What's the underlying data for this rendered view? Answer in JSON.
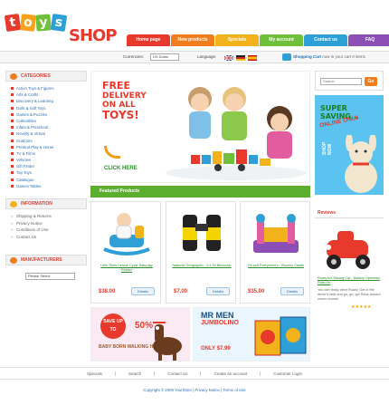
{
  "logo": {
    "blocks": [
      "t",
      "o",
      "y",
      "s"
    ],
    "shop": "SHOP"
  },
  "nav": [
    {
      "label": "Home page",
      "color": "#e7392c"
    },
    {
      "label": "New products",
      "color": "#f07e1f"
    },
    {
      "label": "Specials",
      "color": "#f2b21b"
    },
    {
      "label": "My account",
      "color": "#6fbf3a"
    },
    {
      "label": "Contact us",
      "color": "#2f9fd8"
    },
    {
      "label": "FAQ",
      "color": "#8b4fb5"
    }
  ],
  "toolbar": {
    "currencies_label": "Currencies:",
    "currency_value": "US Dollar",
    "language_label": "Language:",
    "cart_label": "Shopping Cart",
    "cart_status": "now in your cart",
    "cart_count": "0",
    "cart_items": "items"
  },
  "left": {
    "categories_title": "CATEGORIES",
    "categories": [
      "Action Toys & Figures",
      "Arts & Crafts",
      "Discovery & Learning",
      "Dolls & Soft Toys",
      "Games & Puzzles",
      "Collectibles",
      "Infant & Preschool",
      "Novelty & Virtual",
      "Outdoors",
      "Pretend Play & Home",
      "TV & Films",
      "Vehicles",
      "Gift Finder",
      "Top Toys",
      "Catalogue",
      "Games Tables"
    ],
    "information_title": "INFORMATION",
    "information": [
      "Shipping & Returns",
      "Privacy Notice",
      "Conditions of Use",
      "Contact Us"
    ],
    "manufacturers_title": "MANUFACTURERS",
    "manufacturers_select": "Please Select"
  },
  "hero": {
    "line1": "FREE",
    "line2": "DELIVERY",
    "line3": "ON ALL",
    "line4": "TOYS!",
    "cta": "CLICK HERE"
  },
  "featured": {
    "title": "Featured Products",
    "products": [
      {
        "name": "Little Tikes Deluxe Cycle Saturday Rocker",
        "price": "$38.00",
        "button": "Details"
      },
      {
        "name": "National Geographic - 5 x 30 Binocular",
        "price": "$7.00",
        "button": "Details"
      },
      {
        "name": "Kit and Everymore's - Bouncy Castle",
        "price": "$35.00",
        "button": "Details"
      }
    ]
  },
  "promos": {
    "save_badge": "SAVE UP TO",
    "save_pct": "50%",
    "save_text": "BABY BORN WALKING HORSE",
    "mm_line1": "MR MEN",
    "mm_line2": "JUMBOLINO",
    "mm_price": "ONLY $7.99"
  },
  "right": {
    "search_placeholder": "Search",
    "go": "Go",
    "saving_line1": "SUPER",
    "saving_line2": "SAVING...",
    "saving_online": "ONLINE ONLY",
    "saving_shop": "SHOP NOW",
    "reviews_title": "Reviews",
    "review_name": "Roary the Racing Car - Battery Operated Ride-On",
    "review_text": "You can really drive Roary! Get in the driver's seat and go, go, go! Race around vroom vroom!",
    "stars": "★★★★★"
  },
  "footer": {
    "links": [
      "Specials",
      "Search",
      "Contact Us",
      "Create an account",
      "Customer Login"
    ],
    "copyright": "Copyright © 2009 YourStore  |  Privacy Notice  |  Terms of Use"
  }
}
